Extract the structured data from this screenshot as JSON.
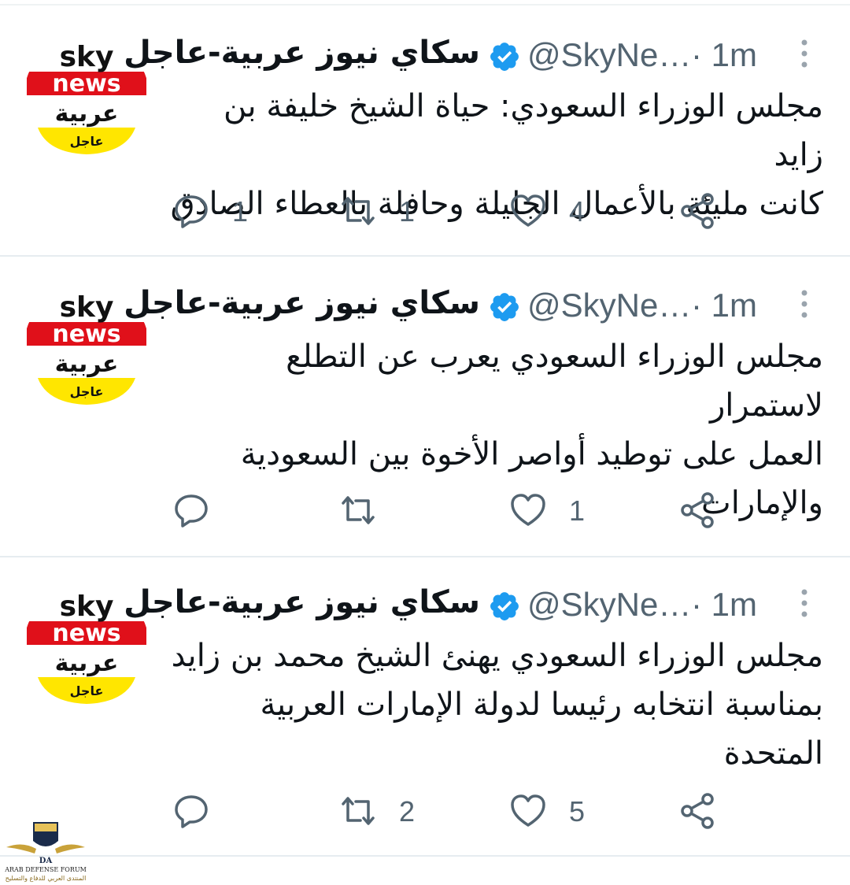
{
  "tweets": [
    {
      "name": "سكاي نيوز عربية-عاجل",
      "handle": "@SkyNe…",
      "time": "· 1m",
      "text_lines": [
        "مجلس الوزراء السعودي: حياة الشيخ خليفة بن زايد",
        "كانت مليئة بالأعمال الجليلة وحافلة بالعطاء الصادق"
      ],
      "replies": "1",
      "retweets": "1",
      "likes": "4"
    },
    {
      "name": "سكاي نيوز عربية-عاجل",
      "handle": "@SkyNe…",
      "time": "· 1m",
      "text_lines": [
        "مجلس الوزراء السعودي يعرب عن التطلع لاستمرار",
        "العمل على توطيد أواصر الأخوة بين السعودية",
        "والإمارات"
      ],
      "replies": "",
      "retweets": "",
      "likes": "1"
    },
    {
      "name": "سكاي نيوز عربية-عاجل",
      "handle": "@SkyNe…",
      "time": "· 1m",
      "text_lines": [
        "مجلس الوزراء السعودي يهنئ الشيخ محمد بن زايد",
        "بمناسبة انتخابه رئيسا لدولة الإمارات العربية",
        "المتحدة"
      ],
      "replies": "",
      "retweets": "2",
      "likes": "5"
    }
  ],
  "avatar": {
    "line1": "sky",
    "line2": "news",
    "line3": "عربية",
    "line4": "عاجل"
  },
  "watermark": {
    "mark": "DA",
    "label": "ARAB DEFENSE FORUM",
    "sub": "المنتدى العربي للدفاع والتسليح"
  },
  "colors": {
    "verified": "#1d9bf0",
    "muted": "#536471",
    "text": "#0f1419",
    "avatar_red": "#e0101a",
    "avatar_yellow": "#ffe600"
  },
  "icons": {
    "reply": "reply-icon",
    "retweet": "retweet-icon",
    "like": "heart-icon",
    "share": "share-icon",
    "verified": "verified-badge-icon",
    "more": "more-icon"
  }
}
